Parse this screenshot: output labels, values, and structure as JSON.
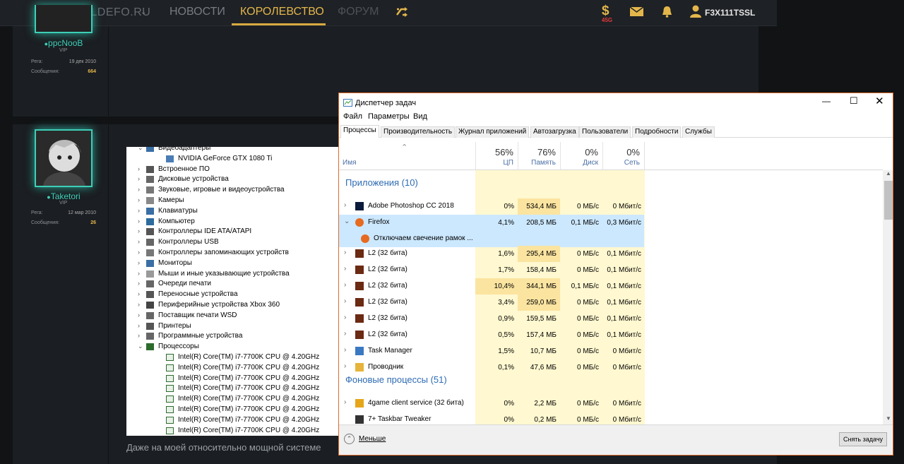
{
  "site": {
    "brand": "DANIELDEFO.RU",
    "nav": [
      "НОВОСТИ",
      "КОРОЛЕВСТВО",
      "ФОРУМ"
    ],
    "active_nav": "КОРОЛЕВСТВО",
    "currency_symbol": "$",
    "currency_count": "45G",
    "username": "F3X111TSSL",
    "accent_color": "#e3b64c"
  },
  "posts": [
    {
      "author": "ppcNooB",
      "rank": "VIP",
      "reg_label": "Рега:",
      "reg_date": "19 дек 2010",
      "msg_label": "Сообщения:",
      "msg_count": "664"
    },
    {
      "author": "Taketori",
      "rank": "VIP",
      "reg_label": "Рега:",
      "reg_date": "12 мар 2010",
      "msg_label": "Сообщения:",
      "msg_count": "26"
    }
  ],
  "post_text": "Даже на моей относительно мощной системе",
  "device_manager": {
    "items": [
      {
        "label": "Видеоадаптеры",
        "expanded": true,
        "child": false
      },
      {
        "label": "NVIDIA GeForce GTX 1080 Ti",
        "expanded": false,
        "child": true
      },
      {
        "label": "Встроенное ПО",
        "expanded": false,
        "child": false
      },
      {
        "label": "Дисковые устройства",
        "expanded": false,
        "child": false
      },
      {
        "label": "Звуковые, игровые и видеоустройства",
        "expanded": false,
        "child": false
      },
      {
        "label": "Камеры",
        "expanded": false,
        "child": false
      },
      {
        "label": "Клавиатуры",
        "expanded": false,
        "child": false
      },
      {
        "label": "Компьютер",
        "expanded": false,
        "child": false
      },
      {
        "label": "Контроллеры IDE ATA/ATAPI",
        "expanded": false,
        "child": false
      },
      {
        "label": "Контроллеры USB",
        "expanded": false,
        "child": false
      },
      {
        "label": "Контроллеры запоминающих устройств",
        "expanded": false,
        "child": false
      },
      {
        "label": "Мониторы",
        "expanded": false,
        "child": false
      },
      {
        "label": "Мыши и иные указывающие устройства",
        "expanded": false,
        "child": false
      },
      {
        "label": "Очереди печати",
        "expanded": false,
        "child": false
      },
      {
        "label": "Переносные устройства",
        "expanded": false,
        "child": false
      },
      {
        "label": "Периферийные устройства Xbox 360",
        "expanded": false,
        "child": false
      },
      {
        "label": "Поставщик печати WSD",
        "expanded": false,
        "child": false
      },
      {
        "label": "Принтеры",
        "expanded": false,
        "child": false
      },
      {
        "label": "Программные устройства",
        "expanded": false,
        "child": false
      },
      {
        "label": "Процессоры",
        "expanded": true,
        "child": false
      },
      {
        "label": "Intel(R) Core(TM) i7-7700K CPU @ 4.20GHz",
        "expanded": false,
        "child": true
      },
      {
        "label": "Intel(R) Core(TM) i7-7700K CPU @ 4.20GHz",
        "expanded": false,
        "child": true
      },
      {
        "label": "Intel(R) Core(TM) i7-7700K CPU @ 4.20GHz",
        "expanded": false,
        "child": true
      },
      {
        "label": "Intel(R) Core(TM) i7-7700K CPU @ 4.20GHz",
        "expanded": false,
        "child": true
      },
      {
        "label": "Intel(R) Core(TM) i7-7700K CPU @ 4.20GHz",
        "expanded": false,
        "child": true
      },
      {
        "label": "Intel(R) Core(TM) i7-7700K CPU @ 4.20GHz",
        "expanded": false,
        "child": true
      },
      {
        "label": "Intel(R) Core(TM) i7-7700K CPU @ 4.20GHz",
        "expanded": false,
        "child": true
      },
      {
        "label": "Intel(R) Core(TM) i7-7700K CPU @ 4.20GHz",
        "expanded": false,
        "child": true
      }
    ]
  },
  "task_manager": {
    "title": "Диспетчер задач",
    "menu": [
      "Файл",
      "Параметры",
      "Вид"
    ],
    "tabs": [
      "Процессы",
      "Производительность",
      "Журнал приложений",
      "Автозагрузка",
      "Пользователи",
      "Подробности",
      "Службы"
    ],
    "selected_tab": "Процессы",
    "col_name": "Имя",
    "columns": [
      {
        "pct": "56%",
        "name": "ЦП"
      },
      {
        "pct": "76%",
        "name": "Память"
      },
      {
        "pct": "0%",
        "name": "Диск"
      },
      {
        "pct": "0%",
        "name": "Сеть"
      }
    ],
    "groups": [
      {
        "label": "Приложения (10)"
      },
      {
        "label": "Фоновые процессы (51)"
      }
    ],
    "processes": [
      {
        "name": "Adobe Photoshop CC 2018",
        "cpu": "0%",
        "mem": "534,4 МБ",
        "disk": "0 МБ/с",
        "net": "0 Мбит/с",
        "icon": "photoshop-icon",
        "expand": "›"
      },
      {
        "name": "Firefox",
        "cpu": "4,1%",
        "mem": "208,5 МБ",
        "disk": "0,1 МБ/с",
        "net": "0,3 Мбит/с",
        "icon": "firefox-icon",
        "expand": "⌄"
      },
      {
        "name": "Отключаем свечение рамок ...",
        "cpu": "",
        "mem": "",
        "disk": "",
        "net": "",
        "icon": "firefox-icon",
        "expand": ""
      },
      {
        "name": "L2 (32 бита)",
        "cpu": "1,6%",
        "mem": "295,4 МБ",
        "disk": "0 МБ/с",
        "net": "0,1 Мбит/с",
        "icon": "l2-icon",
        "expand": "›"
      },
      {
        "name": "L2 (32 бита)",
        "cpu": "1,7%",
        "mem": "158,4 МБ",
        "disk": "0 МБ/с",
        "net": "0,1 Мбит/с",
        "icon": "l2-icon",
        "expand": "›"
      },
      {
        "name": "L2 (32 бита)",
        "cpu": "10,4%",
        "mem": "344,1 МБ",
        "disk": "0,1 МБ/с",
        "net": "0,1 Мбит/с",
        "icon": "l2-icon",
        "expand": "›"
      },
      {
        "name": "L2 (32 бита)",
        "cpu": "3,4%",
        "mem": "259,0 МБ",
        "disk": "0 МБ/с",
        "net": "0,1 Мбит/с",
        "icon": "l2-icon",
        "expand": "›"
      },
      {
        "name": "L2 (32 бита)",
        "cpu": "0,9%",
        "mem": "159,5 МБ",
        "disk": "0 МБ/с",
        "net": "0,1 Мбит/с",
        "icon": "l2-icon",
        "expand": "›"
      },
      {
        "name": "L2 (32 бита)",
        "cpu": "0,5%",
        "mem": "157,4 МБ",
        "disk": "0 МБ/с",
        "net": "0,1 Мбит/с",
        "icon": "l2-icon",
        "expand": "›"
      },
      {
        "name": "Task Manager",
        "cpu": "1,5%",
        "mem": "10,7 МБ",
        "disk": "0 МБ/с",
        "net": "0 Мбит/с",
        "icon": "task-manager-icon",
        "expand": "›"
      },
      {
        "name": "Проводник",
        "cpu": "0,1%",
        "mem": "47,6 МБ",
        "disk": "0 МБ/с",
        "net": "0 Мбит/с",
        "icon": "explorer-icon",
        "expand": "›"
      },
      {
        "name": "4game client service (32 бита)",
        "cpu": "0%",
        "mem": "2,2 МБ",
        "disk": "0 МБ/с",
        "net": "0 Мбит/с",
        "icon": "4game-icon",
        "expand": "›"
      },
      {
        "name": "7+ Taskbar Tweaker",
        "cpu": "0%",
        "mem": "0,2 МБ",
        "disk": "0 МБ/с",
        "net": "0 Мбит/с",
        "icon": "taskbar-tweaker-icon",
        "expand": ""
      }
    ],
    "less_label": "Меньше",
    "end_task_label": "Снять задачу"
  }
}
